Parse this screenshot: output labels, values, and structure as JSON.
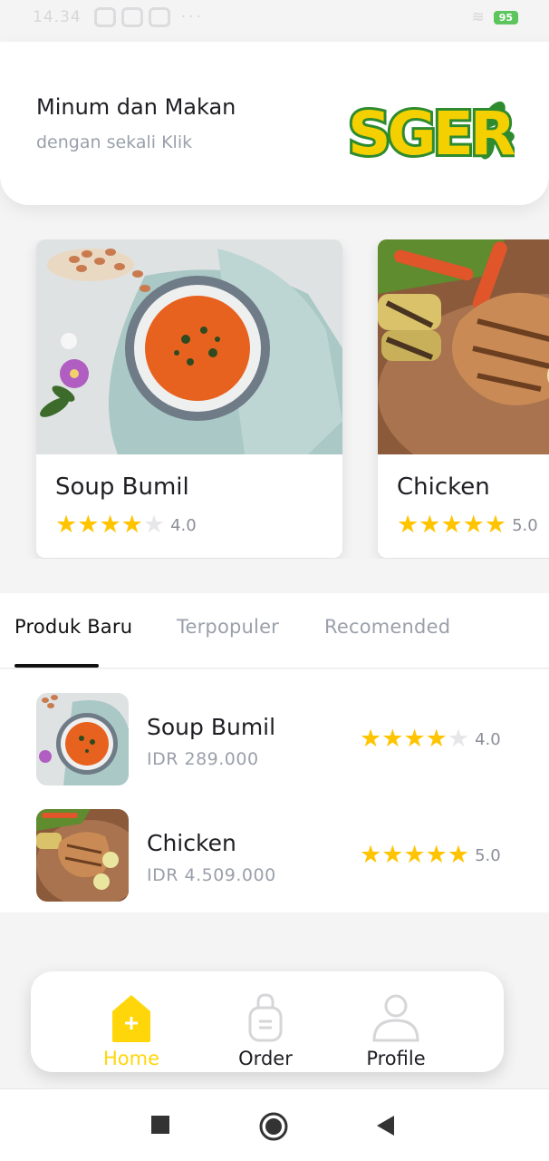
{
  "status_bar": {
    "time": "14.34",
    "battery": "95"
  },
  "header": {
    "title": "Minum dan Makan",
    "subtitle": "dengan sekali Klik",
    "logo_text": "SGER"
  },
  "featured": [
    {
      "name": "Soup Bumil",
      "rating": 4,
      "rating_label": "4.0",
      "image": "tomato-soup"
    },
    {
      "name": "Chicken",
      "rating": 5,
      "rating_label": "5.0",
      "image": "grilled-chicken"
    }
  ],
  "tabs": [
    {
      "label": "Produk Baru",
      "active": true
    },
    {
      "label": "Terpopuler",
      "active": false
    },
    {
      "label": "Recomended",
      "active": false
    }
  ],
  "products": [
    {
      "name": "Soup Bumil",
      "price": "IDR 289.000",
      "rating": 4,
      "rating_label": "4.0",
      "image": "tomato-soup"
    },
    {
      "name": "Chicken",
      "price": "IDR 4.509.000",
      "rating": 5,
      "rating_label": "5.0",
      "image": "grilled-chicken"
    }
  ],
  "bottom_nav": [
    {
      "label": "Home",
      "icon": "home-plus-icon",
      "active": true
    },
    {
      "label": "Order",
      "icon": "bag-icon",
      "active": false
    },
    {
      "label": "Profile",
      "icon": "user-icon",
      "active": false
    }
  ],
  "colors": {
    "accent": "#FFD60A",
    "star": "#FFC400",
    "logo_yellow": "#F5D000",
    "logo_green": "#2E8B2E"
  }
}
